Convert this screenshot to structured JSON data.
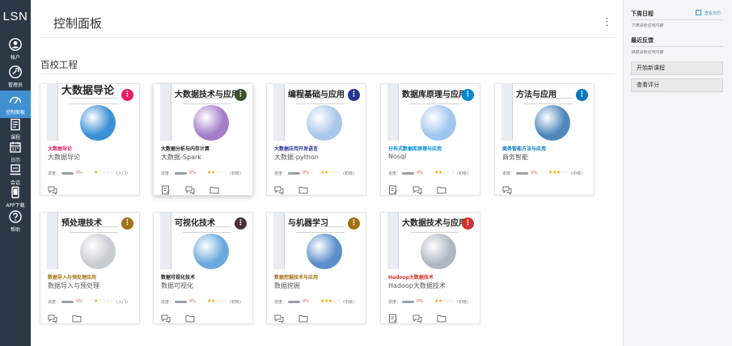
{
  "app": {
    "logo_text": "LSN"
  },
  "sidebar": {
    "items": [
      {
        "label": "帐户",
        "icon": "account-icon"
      },
      {
        "label": "管理员",
        "icon": "admin-icon"
      },
      {
        "label": "控制面板",
        "icon": "dashboard-icon",
        "active": true
      },
      {
        "label": "课程",
        "icon": "course-icon"
      },
      {
        "label": "日历",
        "icon": "calendar-icon"
      },
      {
        "label": "会话",
        "icon": "conversation-icon"
      },
      {
        "label": "APP下载",
        "icon": "mobile-app-icon"
      },
      {
        "label": "帮助",
        "icon": "help-icon"
      }
    ],
    "colors": {
      "background": "#2c3846",
      "active": "#3f8fd1"
    }
  },
  "main": {
    "title": "控制面板",
    "menu_glyph": "⋮",
    "section_title": "百校工程",
    "progress_label": "进度：",
    "courses": [
      {
        "cover_title": "大数据导论",
        "course_name": "大数据导论",
        "class_name": "大数据导论",
        "progress": "0%",
        "stars": 1,
        "level": "(入门)",
        "accent": "#e91e63",
        "name_color": "#e91e63",
        "sphere": "#3a8fd6",
        "icons": [
          "discussion-icon"
        ],
        "menu_glyph": "⋮"
      },
      {
        "cover_title": "大数据技术与应用",
        "course_name": "大数据分析与内存计算",
        "class_name": "大数据-Spark",
        "progress": "0%",
        "stars": 2,
        "level": "(初级)",
        "accent": "#3d4f2e",
        "name_color": "#222222",
        "sphere": "#a47cc9",
        "icons": [
          "assignment-icon",
          "discussion-icon",
          "folder-icon"
        ],
        "menu_glyph": "⋮"
      },
      {
        "cover_title": "编程基础与应用",
        "course_name": "大数据应用开发语言",
        "class_name": "大数据-python",
        "progress": "0%",
        "stars": 2,
        "level": "(初级)",
        "accent": "#283593",
        "name_color": "#283593",
        "sphere": "#a9c7ea",
        "icons": [
          "discussion-icon",
          "folder-icon"
        ],
        "menu_glyph": "⋮"
      },
      {
        "cover_title": "数据库原理与应用",
        "course_name": "分布式数据库原理与应用",
        "class_name": "Nosql",
        "progress": "0%",
        "stars": 2,
        "level": "(初级)",
        "accent": "#0288d1",
        "name_color": "#0288d1",
        "sphere": "#9fc6ee",
        "icons": [
          "assignment-icon",
          "discussion-icon",
          "folder-icon"
        ],
        "menu_glyph": "⋮"
      },
      {
        "cover_title": "方法与应用",
        "course_name": "商务智能方法与应用",
        "class_name": "商务智能",
        "progress": "0%",
        "stars": 3,
        "level": "(中级)",
        "accent": "#0277bd",
        "name_color": "#0277bd",
        "sphere": "#4f87bd",
        "icons": [
          "discussion-icon"
        ],
        "menu_glyph": "⋮"
      },
      {
        "cover_title": "预处理技术",
        "course_name": "数据导入与预处理应用",
        "class_name": "数据导入与预处理",
        "progress": "0%",
        "stars": 1,
        "level": "(入门)",
        "accent": "#a07117",
        "name_color": "#a07117",
        "sphere": "#c7ccd1",
        "icons": [
          "discussion-icon",
          "folder-icon"
        ],
        "menu_glyph": "⋮"
      },
      {
        "cover_title": "可视化技术",
        "course_name": "数据可视化技术",
        "class_name": "数据可视化",
        "progress": "0%",
        "stars": 2,
        "level": "(初级)",
        "accent": "#4a2e3a",
        "name_color": "#222222",
        "sphere": "#6aa9dd",
        "icons": [
          "discussion-icon",
          "folder-icon"
        ],
        "menu_glyph": "⋮"
      },
      {
        "cover_title": "与机器学习",
        "course_name": "数据挖掘技术与应用",
        "class_name": "数据挖掘",
        "progress": "0%",
        "stars": 3,
        "level": "(中级)",
        "accent": "#a07117",
        "name_color": "#a07117",
        "sphere": "#5b8fcc",
        "icons": [
          "discussion-icon",
          "folder-icon"
        ],
        "menu_glyph": "⋮"
      },
      {
        "cover_title": "大数据技术与应用",
        "course_name": "Hadoop大数据技术",
        "class_name": "Hadoop大数据技术",
        "progress": "0%",
        "stars": 2,
        "level": "(初级)",
        "accent": "#d32f2f",
        "name_color": "#d32f2f",
        "sphere": "#aeb7c2",
        "icons": [
          "assignment-icon",
          "discussion-icon",
          "folder-icon"
        ],
        "menu_glyph": "⋮"
      }
    ]
  },
  "right_panel": {
    "upcoming_title": "下周日程",
    "calendar_link": "查看日历",
    "upcoming_note": "下周没有任何内容",
    "feedback_title": "最近反馈",
    "feedback_note": "目前没有任何内容",
    "buttons": [
      "开始新课程",
      "查看评分"
    ]
  }
}
